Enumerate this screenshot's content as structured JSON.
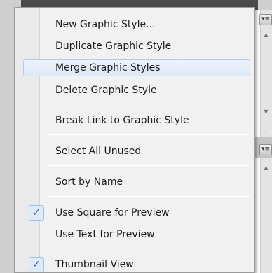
{
  "menu": {
    "items": [
      {
        "label": "New Graphic Style..."
      },
      {
        "label": "Duplicate Graphic Style"
      },
      {
        "label": "Merge Graphic Styles"
      },
      {
        "label": "Delete Graphic Style"
      },
      {
        "label": "Break Link to Graphic Style"
      },
      {
        "label": "Select All Unused"
      },
      {
        "label": "Sort by Name"
      },
      {
        "label": "Use Square for Preview",
        "checked": true
      },
      {
        "label": "Use Text for Preview"
      },
      {
        "label": "Thumbnail View",
        "checked": true
      }
    ],
    "check_glyph": "✓",
    "highlighted_item": "Merge Graphic Styles"
  },
  "background_panel": {
    "menu_icon": "panel-menu-icon",
    "scroll_up_icon": "scroll-up-arrow-icon",
    "scroll_down_icon": "scroll-down-arrow-icon"
  }
}
